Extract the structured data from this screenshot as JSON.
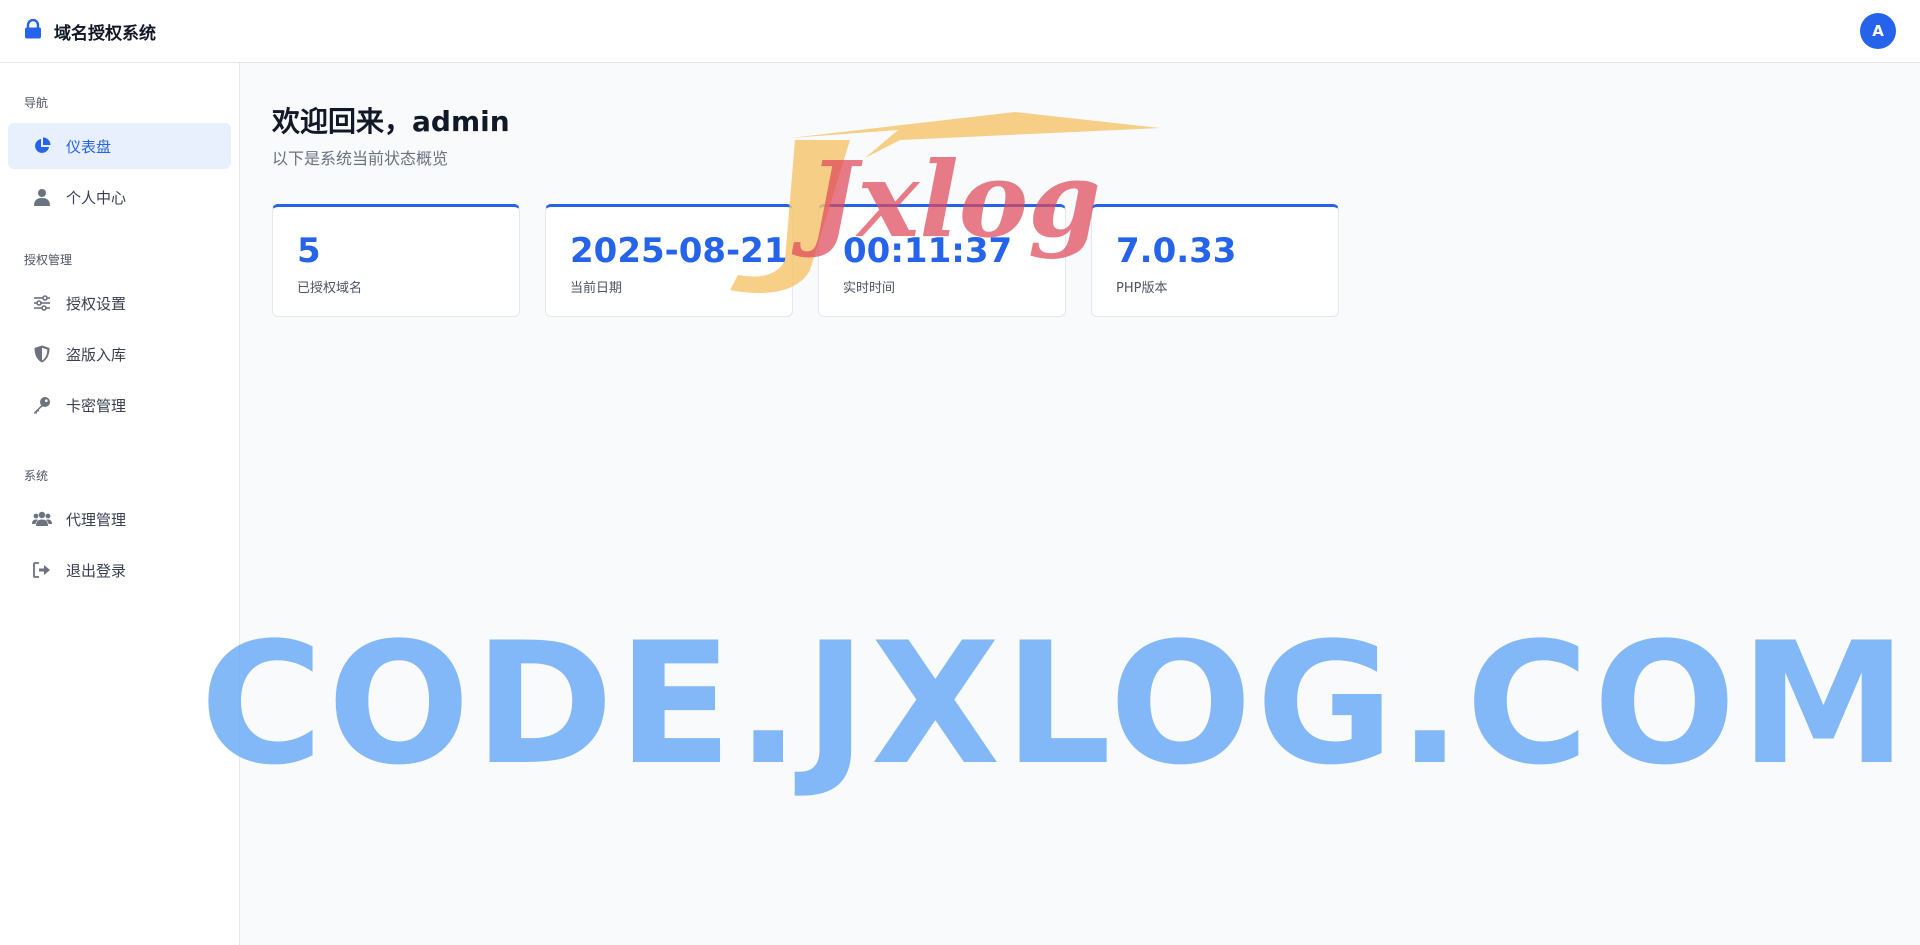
{
  "app": {
    "title": "域名授权系统",
    "avatar_letter": "A"
  },
  "sidebar": {
    "sections": [
      {
        "label": "导航",
        "items": [
          {
            "label": "仪表盘",
            "icon": "chart-pie-icon",
            "active": true
          },
          {
            "label": "个人中心",
            "icon": "user-icon"
          }
        ]
      },
      {
        "label": "授权管理",
        "items": [
          {
            "label": "授权设置",
            "icon": "sliders-icon"
          },
          {
            "label": "盗版入库",
            "icon": "shield-icon"
          },
          {
            "label": "卡密管理",
            "icon": "key-icon"
          }
        ]
      },
      {
        "label": "系统",
        "items": [
          {
            "label": "代理管理",
            "icon": "users-icon"
          },
          {
            "label": "退出登录",
            "icon": "logout-icon"
          }
        ]
      }
    ]
  },
  "main": {
    "welcome": "欢迎回来，admin",
    "subtitle": "以下是系统当前状态概览",
    "cards": [
      {
        "value": "5",
        "label": "已授权域名"
      },
      {
        "value": "2025-08-21",
        "label": "当前日期"
      },
      {
        "value": "00:11:37",
        "label": "实时时间"
      },
      {
        "value": "7.0.33",
        "label": "PHP版本"
      }
    ]
  },
  "watermarks": {
    "logo_text": "Jxlog",
    "big_text": "CODE.JXLOG.COM"
  },
  "colors": {
    "accent": "#2563eb",
    "active_bg": "#e8effd",
    "watermark_blue": "#60a5f5",
    "watermark_red": "#df485a",
    "watermark_orange": "#f7c56b"
  }
}
